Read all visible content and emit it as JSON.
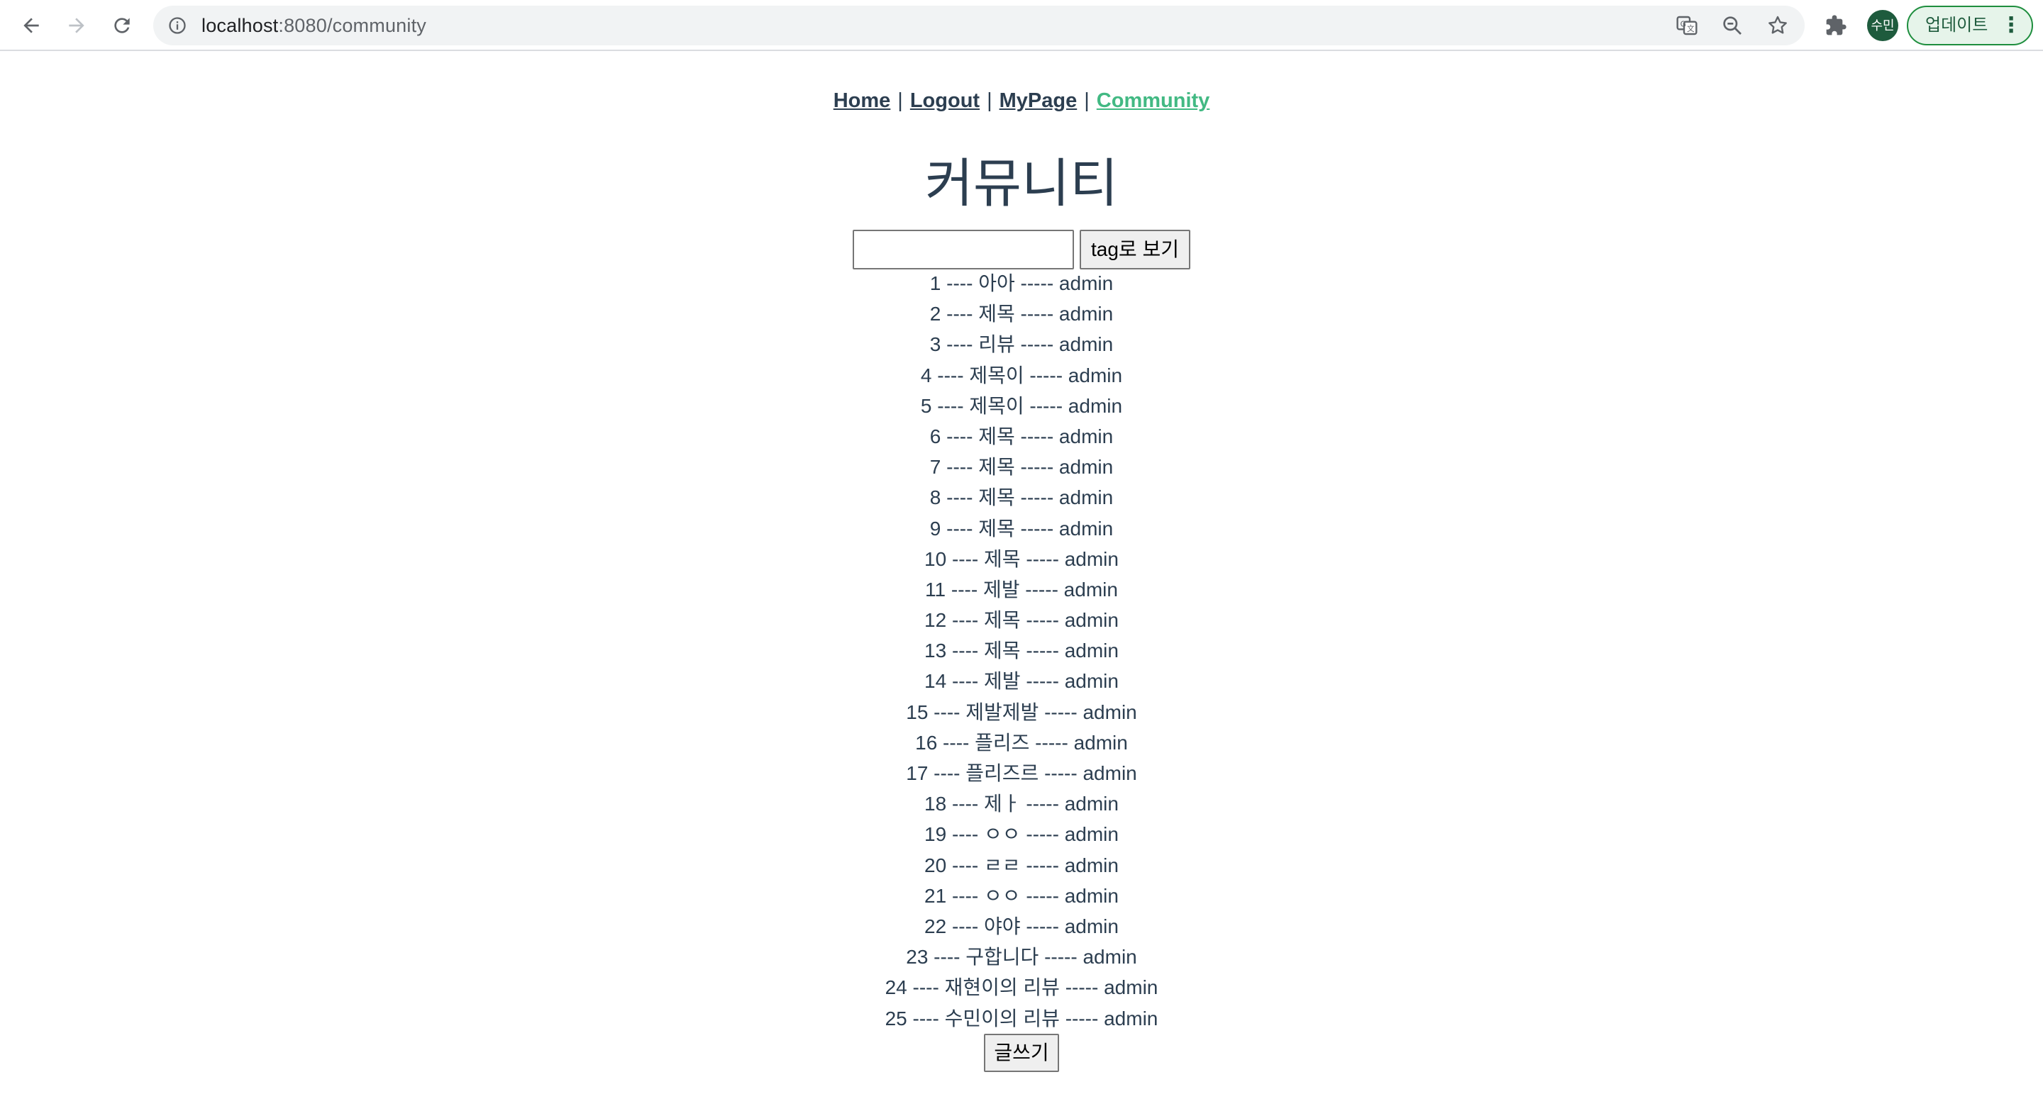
{
  "browser": {
    "url_host": "localhost",
    "url_rest": ":8080/community",
    "profile_initials": "수민",
    "update_label": "업데이트",
    "icons": [
      "back-icon",
      "forward-icon",
      "reload-icon",
      "info-icon",
      "translate-icon",
      "zoom-icon",
      "bookmark-star-icon",
      "extensions-icon",
      "kebab-menu-icon"
    ]
  },
  "nav": {
    "home": "Home",
    "logout": "Logout",
    "mypage": "MyPage",
    "community": "Community",
    "separator": "|"
  },
  "page": {
    "title": "커뮤니티",
    "tag_input_value": "",
    "tag_button_label": "tag로 보기",
    "write_button_label": "글쓰기"
  },
  "posts": [
    "1 ---- 아아 ----- admin",
    "2 ---- 제목 ----- admin",
    "3 ---- 리뷰 ----- admin",
    "4 ---- 제목이 ----- admin",
    "5 ---- 제목이 ----- admin",
    "6 ---- 제목 ----- admin",
    "7 ---- 제목 ----- admin",
    "8 ---- 제목 ----- admin",
    "9 ---- 제목 ----- admin",
    "10 ---- 제목 ----- admin",
    "11 ---- 제발 ----- admin",
    "12 ---- 제목 ----- admin",
    "13 ---- 제목 ----- admin",
    "14 ---- 제발 ----- admin",
    "15 ---- 제발제발 ----- admin",
    "16 ---- 플리즈 ----- admin",
    "17 ---- 플리즈르 ----- admin",
    "18 ---- 제ㅏ ----- admin",
    "19 ---- ㅇㅇ ----- admin",
    "20 ---- ㄹㄹ ----- admin",
    "21 ---- ㅇㅇ ----- admin",
    "22 ---- 야야 ----- admin",
    "23 ---- 구합니다 ----- admin",
    "24 ---- 재현이의 리뷰 ----- admin",
    "25 ---- 수민이의 리뷰 ----- admin"
  ],
  "colors": {
    "text": "#2c3e50",
    "active_link": "#42b983",
    "update_border": "#1e8e3e"
  }
}
